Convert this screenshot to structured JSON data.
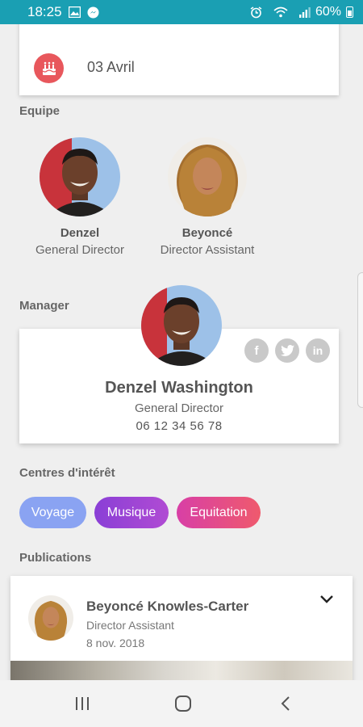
{
  "status_bar": {
    "time": "18:25",
    "battery": "60%"
  },
  "birthday": {
    "date": "03 Avril"
  },
  "team": {
    "title": "Equipe",
    "members": [
      {
        "name": "Denzel",
        "role": "General Director"
      },
      {
        "name": "Beyoncé",
        "role": "Director Assistant"
      }
    ]
  },
  "manager": {
    "title": "Manager",
    "name": "Denzel Washington",
    "role": "General Director",
    "phone": "06 12 34 56 78",
    "social": {
      "facebook": "f",
      "linkedin": "in"
    }
  },
  "interests": {
    "title": "Centres d'intérêt",
    "chips": [
      {
        "label": "Voyage",
        "color": "#8aa3f2"
      },
      {
        "label": "Musique",
        "color": "#9b3fd6"
      },
      {
        "label": "Equitation",
        "color": "#e8458f"
      }
    ]
  },
  "publications": {
    "title": "Publications",
    "items": [
      {
        "author": "Beyoncé Knowles-Carter",
        "role": "Director Assistant",
        "date": "8 nov. 2018"
      }
    ]
  },
  "colors": {
    "status_bar": "#1a9fb3",
    "cake_icon": "#e8575c",
    "background": "#efefef"
  }
}
